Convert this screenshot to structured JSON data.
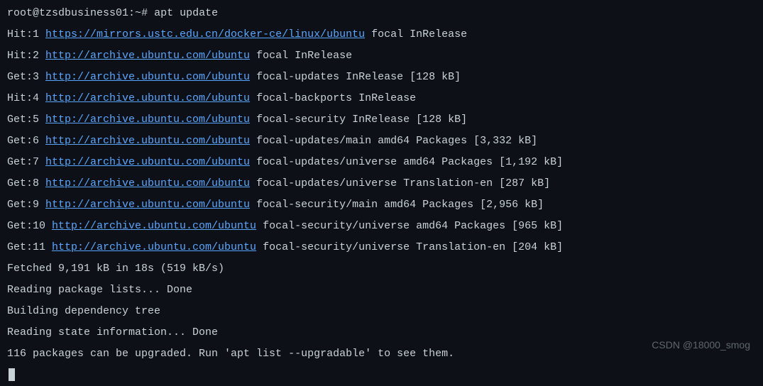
{
  "prompt": {
    "user_host": "root@tzsdbusiness01",
    "cwd": "~",
    "symbol": "#",
    "command": "apt update"
  },
  "sources": [
    {
      "prefix": "Hit:1",
      "url": "https://mirrors.ustc.edu.cn/docker-ce/linux/ubuntu",
      "suffix": "focal InRelease"
    },
    {
      "prefix": "Hit:2",
      "url": "http://archive.ubuntu.com/ubuntu",
      "suffix": "focal InRelease"
    },
    {
      "prefix": "Get:3",
      "url": "http://archive.ubuntu.com/ubuntu",
      "suffix": "focal-updates InRelease [128 kB]"
    },
    {
      "prefix": "Hit:4",
      "url": "http://archive.ubuntu.com/ubuntu",
      "suffix": "focal-backports InRelease"
    },
    {
      "prefix": "Get:5",
      "url": "http://archive.ubuntu.com/ubuntu",
      "suffix": "focal-security InRelease [128 kB]"
    },
    {
      "prefix": "Get:6",
      "url": "http://archive.ubuntu.com/ubuntu",
      "suffix": "focal-updates/main amd64 Packages [3,332 kB]"
    },
    {
      "prefix": "Get:7",
      "url": "http://archive.ubuntu.com/ubuntu",
      "suffix": "focal-updates/universe amd64 Packages [1,192 kB]"
    },
    {
      "prefix": "Get:8",
      "url": "http://archive.ubuntu.com/ubuntu",
      "suffix": "focal-updates/universe Translation-en [287 kB]"
    },
    {
      "prefix": "Get:9",
      "url": "http://archive.ubuntu.com/ubuntu",
      "suffix": "focal-security/main amd64 Packages [2,956 kB]"
    },
    {
      "prefix": "Get:10",
      "url": "http://archive.ubuntu.com/ubuntu",
      "suffix": "focal-security/universe amd64 Packages [965 kB]"
    },
    {
      "prefix": "Get:11",
      "url": "http://archive.ubuntu.com/ubuntu",
      "suffix": "focal-security/universe Translation-en [204 kB]"
    }
  ],
  "summary": [
    "Fetched 9,191 kB in 18s (519 kB/s)",
    "Reading package lists... Done",
    "Building dependency tree",
    "Reading state information... Done",
    "116 packages can be upgraded. Run 'apt list --upgradable' to see them."
  ],
  "watermark": "CSDN @18000_smog"
}
